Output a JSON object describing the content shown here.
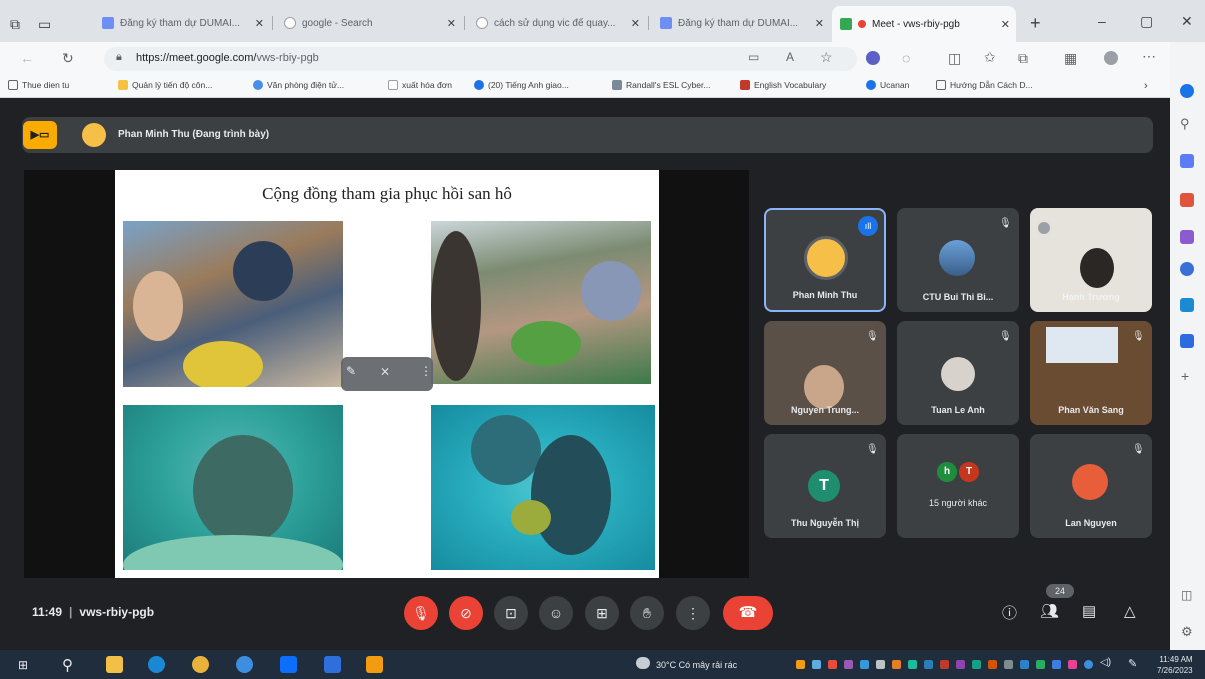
{
  "browser": {
    "tabs": [
      {
        "title": "Đăng ký tham dự DUMAI...",
        "active": false
      },
      {
        "title": "google - Search",
        "active": false
      },
      {
        "title": "cách sử dụng vic để quay...",
        "active": false
      },
      {
        "title": "Đăng ký tham dự DUMAI...",
        "active": false
      },
      {
        "title": "Meet - vws-rbiy-pgb",
        "active": true
      }
    ],
    "new_tab": "+",
    "window_controls": {
      "minimize": "–",
      "maximize": "▢",
      "close": "✕"
    },
    "url_host": "https://meet.google.com/",
    "url_path": "vws-rbiy-pgb",
    "bookmarks": [
      "Thue dien tu",
      "Quản lý tiến độ côn...",
      "Văn phòng điện tử...",
      "xuất hóa đơn",
      "(20) Tiếng Anh giao...",
      "Randall's ESL Cyber...",
      "English Vocabulary",
      "Ucanan",
      "Hướng Dẫn Cách D..."
    ]
  },
  "meet": {
    "presenter_banner": "Phan Minh Thu (Đang trình bày)",
    "slide": {
      "title": "Cộng đồng tham gia phục hồi san hô"
    },
    "participants": [
      {
        "name": "Phan Minh Thu",
        "speaking": true
      },
      {
        "name": "CTU Bui Thi Bi...",
        "speaking": false
      },
      {
        "name": "Hạnh Trương",
        "speaking": false
      },
      {
        "name": "Nguyen Trung...",
        "speaking": false
      },
      {
        "name": "Tuan Le Anh",
        "speaking": false
      },
      {
        "name": "Phan Văn Sang",
        "speaking": false
      },
      {
        "name": "Thu Nguyễn Thị",
        "speaking": false,
        "initial": "T"
      },
      {
        "name": "15 người khác",
        "speaking": false,
        "initials": [
          "h",
          "T"
        ]
      },
      {
        "name": "Lan Nguyen",
        "speaking": false
      }
    ],
    "time": "11:49",
    "meeting_code": "vws-rbiy-pgb",
    "participant_count": "24",
    "controls": [
      "mic-off-icon",
      "camera-off-icon",
      "captions-icon",
      "emoji-icon",
      "present-icon",
      "raise-hand-icon",
      "more-icon"
    ],
    "colors": {
      "red": "#ea4335",
      "surface": "#3c4043",
      "background": "#202124",
      "accent": "#8ab4f8",
      "presenter": "#f9ab00"
    }
  },
  "taskbar": {
    "weather": "30°C  Có mây rải rác",
    "clock_time": "11:49 AM",
    "clock_date": "7/26/2023"
  }
}
